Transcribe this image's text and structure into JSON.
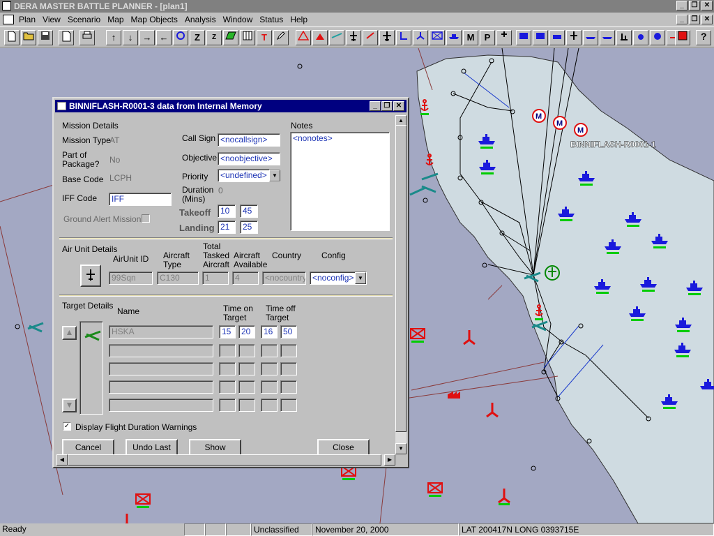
{
  "app": {
    "title": "DERA MASTER BATTLE PLANNER - [plan1]",
    "window_buttons": [
      "_",
      "❐",
      "✕"
    ]
  },
  "menu": [
    "Plan",
    "View",
    "Scenario",
    "Map",
    "Map Objects",
    "Analysis",
    "Window",
    "Status",
    "Help"
  ],
  "toolbar": {
    "glyphs": [
      "↑",
      "↓",
      "→",
      "←",
      "Z",
      "Z",
      "T",
      "M",
      "P"
    ]
  },
  "map": {
    "label_mission": "BINNIFLASH-R0001-1",
    "colors": {
      "sea": "#a3a8c3",
      "land": "#cfdbe1",
      "ship": "#1a1adc",
      "hostile": "#e01010",
      "route": "#000000",
      "friendly": "#00aa00"
    }
  },
  "dialog": {
    "title": "BINNIFLASH-R0001-3 data from Internal Memory",
    "mission": {
      "section": "Mission Details",
      "mission_type_label": "Mission Type",
      "mission_type": "AT",
      "package_label_1": "Part of",
      "package_label_2": "Package?",
      "package": "No",
      "base_code_label": "Base Code",
      "base_code": "LCPH",
      "iff_label": "IFF Code",
      "iff": "IFF",
      "ground_alert_label": "Ground Alert Mission?",
      "call_sign_label": "Call Sign",
      "call_sign": "<nocallsign>",
      "objective_label": "Objective",
      "objective": "<noobjective>",
      "priority_label": "Priority",
      "priority": "<undefined>",
      "duration_label_1": "Duration",
      "duration_label_2": "(Mins)",
      "duration": "0",
      "takeoff_label": "Takeoff",
      "takeoff_h": "10",
      "takeoff_m": "45",
      "landing_label": "Landing",
      "landing_h": "21",
      "landing_m": "25",
      "notes_label": "Notes",
      "notes": "<nonotes>"
    },
    "air_unit": {
      "section": "Air Unit Details",
      "col_id": "AirUnit ID",
      "col_type_1": "Aircraft",
      "col_type_2": "Type",
      "col_tasked_1": "Total",
      "col_tasked_2": "Tasked",
      "col_tasked_3": "Aircraft",
      "col_avail_1": "Aircraft",
      "col_avail_2": "Available",
      "col_country": "Country",
      "col_config": "Config",
      "id": "99Sqn",
      "type": "C130",
      "tasked": "1",
      "available": "4",
      "country": "<nocountry>",
      "config": "<noconfig>"
    },
    "targets": {
      "section": "Target Details",
      "col_name": "Name",
      "col_on_1": "Time on",
      "col_on_2": "Target",
      "col_off_1": "Time off",
      "col_off_2": "Target",
      "rows": [
        {
          "name": "HSKA",
          "on_h": "15",
          "on_m": "20",
          "off_h": "16",
          "off_m": "50"
        },
        {
          "name": "",
          "on_h": "",
          "on_m": "",
          "off_h": "",
          "off_m": ""
        },
        {
          "name": "",
          "on_h": "",
          "on_m": "",
          "off_h": "",
          "off_m": ""
        },
        {
          "name": "",
          "on_h": "",
          "on_m": "",
          "off_h": "",
          "off_m": ""
        },
        {
          "name": "",
          "on_h": "",
          "on_m": "",
          "off_h": "",
          "off_m": ""
        }
      ]
    },
    "warnings_label": "Display Flight Duration Warnings",
    "buttons": {
      "cancel": "Cancel",
      "undo": "Undo Last",
      "show": "Show Mission",
      "close": "Close"
    }
  },
  "status": {
    "ready": "Ready",
    "classification": "Unclassified",
    "date": "November 20, 2000",
    "position": "LAT 200417N  LONG 0393715E"
  }
}
